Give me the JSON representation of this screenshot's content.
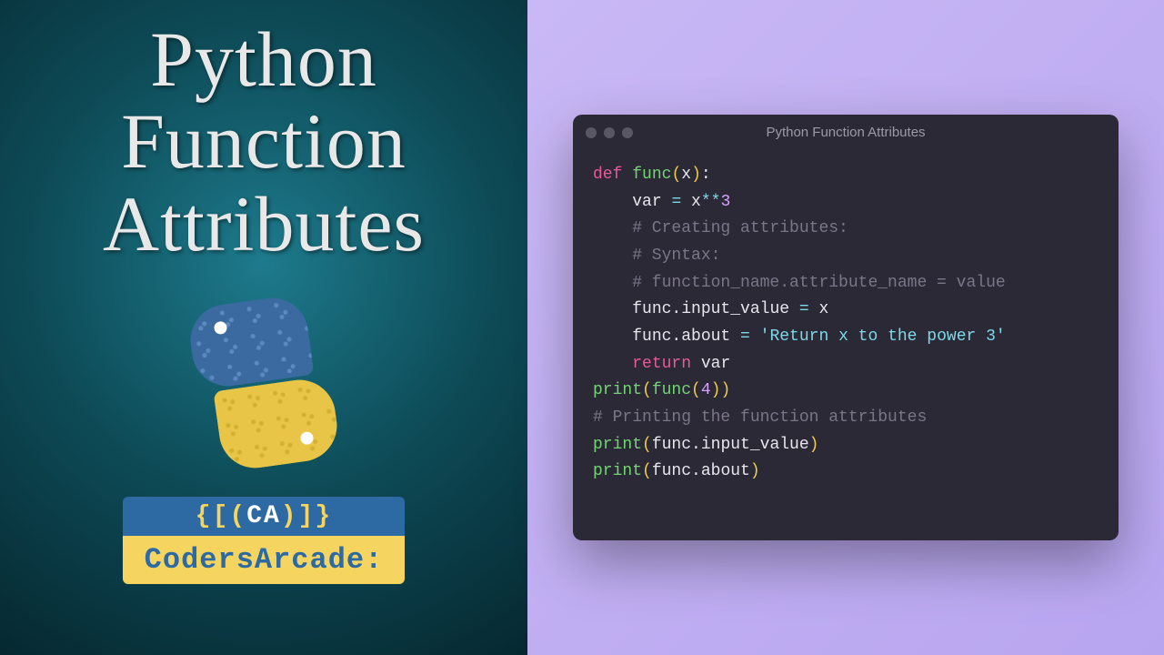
{
  "left": {
    "title_line1": "Python",
    "title_line2": "Function",
    "title_line3": "Attributes",
    "badge_top_open": "{[(",
    "badge_top_mid": "CA",
    "badge_top_close": ")]}",
    "badge_bottom": "CodersArcade:"
  },
  "editor": {
    "title": "Python Function Attributes",
    "code": {
      "l1": {
        "def": "def ",
        "name": "func",
        "po": "(",
        "arg": "x",
        "pc": ")",
        "colon": ":"
      },
      "l2": {
        "indent": "    ",
        "var": "var ",
        "eq": "= ",
        "x": "x",
        "op": "**",
        "num": "3"
      },
      "l3": "    # Creating attributes:",
      "l4": "    # Syntax:",
      "l5": "    # function_name.attribute_name = value",
      "l6": {
        "indent": "    ",
        "a": "func.input_value ",
        "eq": "= ",
        "v": "x"
      },
      "l7": {
        "indent": "    ",
        "a": "func.about ",
        "eq": "= ",
        "str": "'Return x to the power 3'"
      },
      "l8": {
        "indent": "    ",
        "ret": "return ",
        "v": "var"
      },
      "blank": "",
      "l10": {
        "call": "print",
        "po": "(",
        "fn": "func",
        "po2": "(",
        "num": "4",
        "pc2": ")",
        "pc": ")"
      },
      "l11": "# Printing the function attributes",
      "l12": {
        "call": "print",
        "po": "(",
        "arg": "func.input_value",
        "pc": ")"
      },
      "l13": {
        "call": "print",
        "po": "(",
        "arg": "func.about",
        "pc": ")"
      }
    }
  }
}
